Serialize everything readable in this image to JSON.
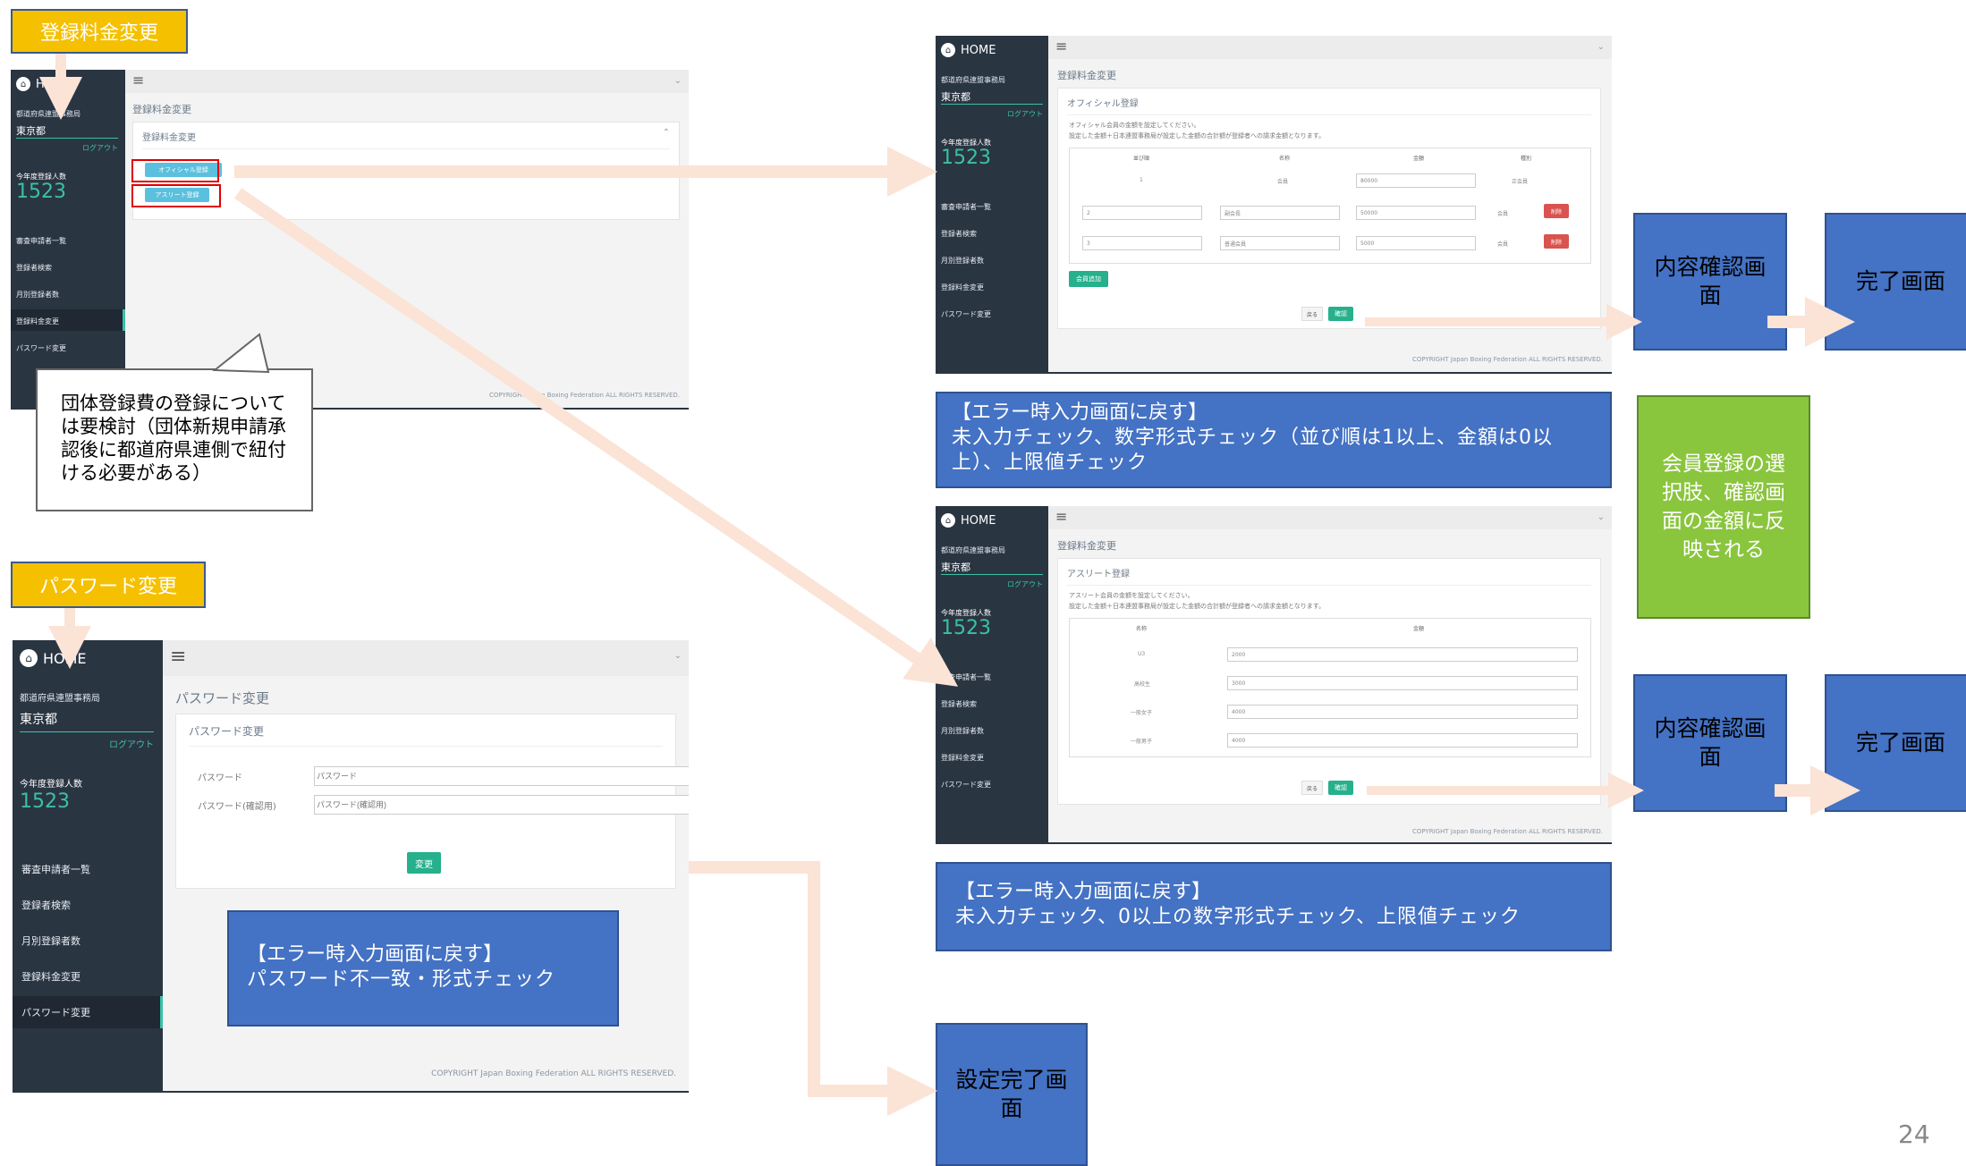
{
  "labels": {
    "fee_change": "登録料金変更",
    "password_change": "パスワード変更"
  },
  "app": {
    "home": "HOME",
    "org": "都道府県連盟事務局",
    "pref": "東京都",
    "logout": "ログアウト",
    "count_label": "今年度登録人数",
    "count": "1523",
    "nav": [
      "審査申請者一覧",
      "登録者検索",
      "月別登録者数",
      "登録料金変更",
      "パスワード変更"
    ],
    "footer": "COPYRIGHT Japan Boxing Federation ALL RIGHTS RESERVED."
  },
  "fee_screen": {
    "crumb": "登録料金変更",
    "panel_title": "登録料金変更",
    "official_btn": "オフィシャル登録",
    "athlete_btn": "アスリート登録"
  },
  "official_screen": {
    "crumb": "登録料金変更",
    "panel_title": "オフィシャル登録",
    "note1": "オフィシャル会員の金額を設定してください。",
    "note2": "設定した金額＋日本連盟事務局が設定した金額の合計額が登録者への請求金額となります。",
    "headers": [
      "並び順",
      "名称",
      "金額",
      "種別"
    ],
    "rows": [
      {
        "order": "1",
        "name": "会員",
        "amount": "80000",
        "type": "正会員"
      },
      {
        "order": "2",
        "name": "副会長",
        "amount": "50000",
        "type": "会員",
        "del": "削除"
      },
      {
        "order": "3",
        "name": "普通会員",
        "amount": "5000",
        "type": "会員",
        "del": "削除"
      }
    ],
    "add_btn": "会員追加",
    "back_btn": "戻る",
    "confirm_btn": "確認"
  },
  "athlete_screen": {
    "crumb": "登録料金変更",
    "panel_title": "アスリート登録",
    "note1": "アスリート会員の金額を設定してください。",
    "note2": "設定した金額＋日本連盟事務局が設定した金額の合計額が登録者への請求金額となります。",
    "headers": [
      "名称",
      "金額"
    ],
    "rows": [
      {
        "name": "U3",
        "amount": "2000"
      },
      {
        "name": "高校生",
        "amount": "3000"
      },
      {
        "name": "一般女子",
        "amount": "4000"
      },
      {
        "name": "一般男子",
        "amount": "4000"
      }
    ],
    "back_btn": "戻る",
    "confirm_btn": "確認"
  },
  "password_screen": {
    "crumb": "パスワード変更",
    "panel_title": "パスワード変更",
    "pw_label": "パスワード",
    "pw_placeholder": "パスワード",
    "pw2_label": "パスワード(確認用)",
    "pw2_placeholder": "パスワード(確認用)",
    "submit_btn": "変更"
  },
  "callout": "団体登録費の登録については要検討（団体新規申請承認後に都道府県連側で紐付ける必要がある）",
  "errors": {
    "official_title": "【エラー時入力画面に戻す】",
    "official_body": "未入力チェック、数字形式チェック（並び順は1以上、金額は0以上）、上限値チェック",
    "athlete_title": "【エラー時入力画面に戻す】",
    "athlete_body": "未入力チェック、0以上の数字形式チェック、上限値チェック",
    "password_title": "【エラー時入力画面に戻す】",
    "password_body": "パスワード不一致・形式チェック"
  },
  "flow": {
    "confirm": "内容確認画面",
    "complete": "完了画面",
    "member_note": "会員登録の選択肢、確認画面の金額に反映される",
    "setting_done": "設定完了画面"
  },
  "page_number": "24",
  "colors": {
    "sidebar": "#2a3542",
    "accent": "#3bc0a6",
    "flow_blue": "#4472c4",
    "label_yellow": "#f5c000",
    "note_green": "#8ac53e",
    "arrow": "#fbe3d6"
  }
}
